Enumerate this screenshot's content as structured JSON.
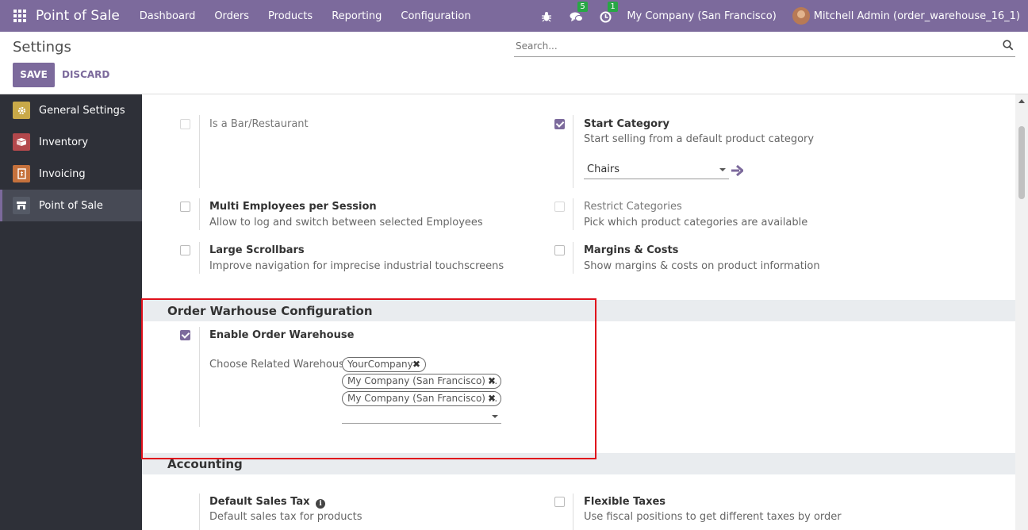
{
  "navbar": {
    "brand": "Point of Sale",
    "menu": [
      "Dashboard",
      "Orders",
      "Products",
      "Reporting",
      "Configuration"
    ],
    "messages_count": "5",
    "activities_count": "1",
    "company": "My Company (San Francisco)",
    "user": "Mitchell Admin (order_warehouse_16_1)"
  },
  "control": {
    "title": "Settings",
    "save_label": "SAVE",
    "discard_label": "DISCARD",
    "search_placeholder": "Search..."
  },
  "sidebar": {
    "items": [
      {
        "label": "General Settings",
        "color": "#c9a948"
      },
      {
        "label": "Inventory",
        "color": "#b3484c"
      },
      {
        "label": "Invoicing",
        "color": "#c5713c"
      },
      {
        "label": "Point of Sale",
        "color": "#555a66"
      }
    ]
  },
  "settings": {
    "bar": {
      "title": "Is a Bar/Restaurant"
    },
    "start_category": {
      "title": "Start Category",
      "desc": "Start selling from a default product category",
      "value": "Chairs"
    },
    "multi_employees": {
      "title": "Multi Employees per Session",
      "desc": "Allow to log and switch between selected Employees"
    },
    "restrict_categories": {
      "title": "Restrict Categories",
      "desc": "Pick which product categories are available"
    },
    "large_scrollbars": {
      "title": "Large Scrollbars",
      "desc": "Improve navigation for imprecise industrial touchscreens"
    },
    "margins_costs": {
      "title": "Margins & Costs",
      "desc": "Show margins & costs on product information"
    }
  },
  "order_warehouse": {
    "section_title": "Order Warhouse Configuration",
    "enable_title": "Enable Order Warehouse",
    "choose_label": "Choose Related Warehouse",
    "tags": [
      "YourCompany",
      "My Company (San Francisco) ...",
      "My Company (San Francisco) ..."
    ]
  },
  "accounting": {
    "section_title": "Accounting",
    "default_tax": {
      "title": "Default Sales Tax",
      "desc": "Default sales tax for products"
    },
    "flexible_taxes": {
      "title": "Flexible Taxes",
      "desc": "Use fiscal positions to get different taxes by order"
    }
  },
  "colors": {
    "brand": "#7c6a9c",
    "highlight": "#e0111c",
    "badge": "#28a745"
  }
}
